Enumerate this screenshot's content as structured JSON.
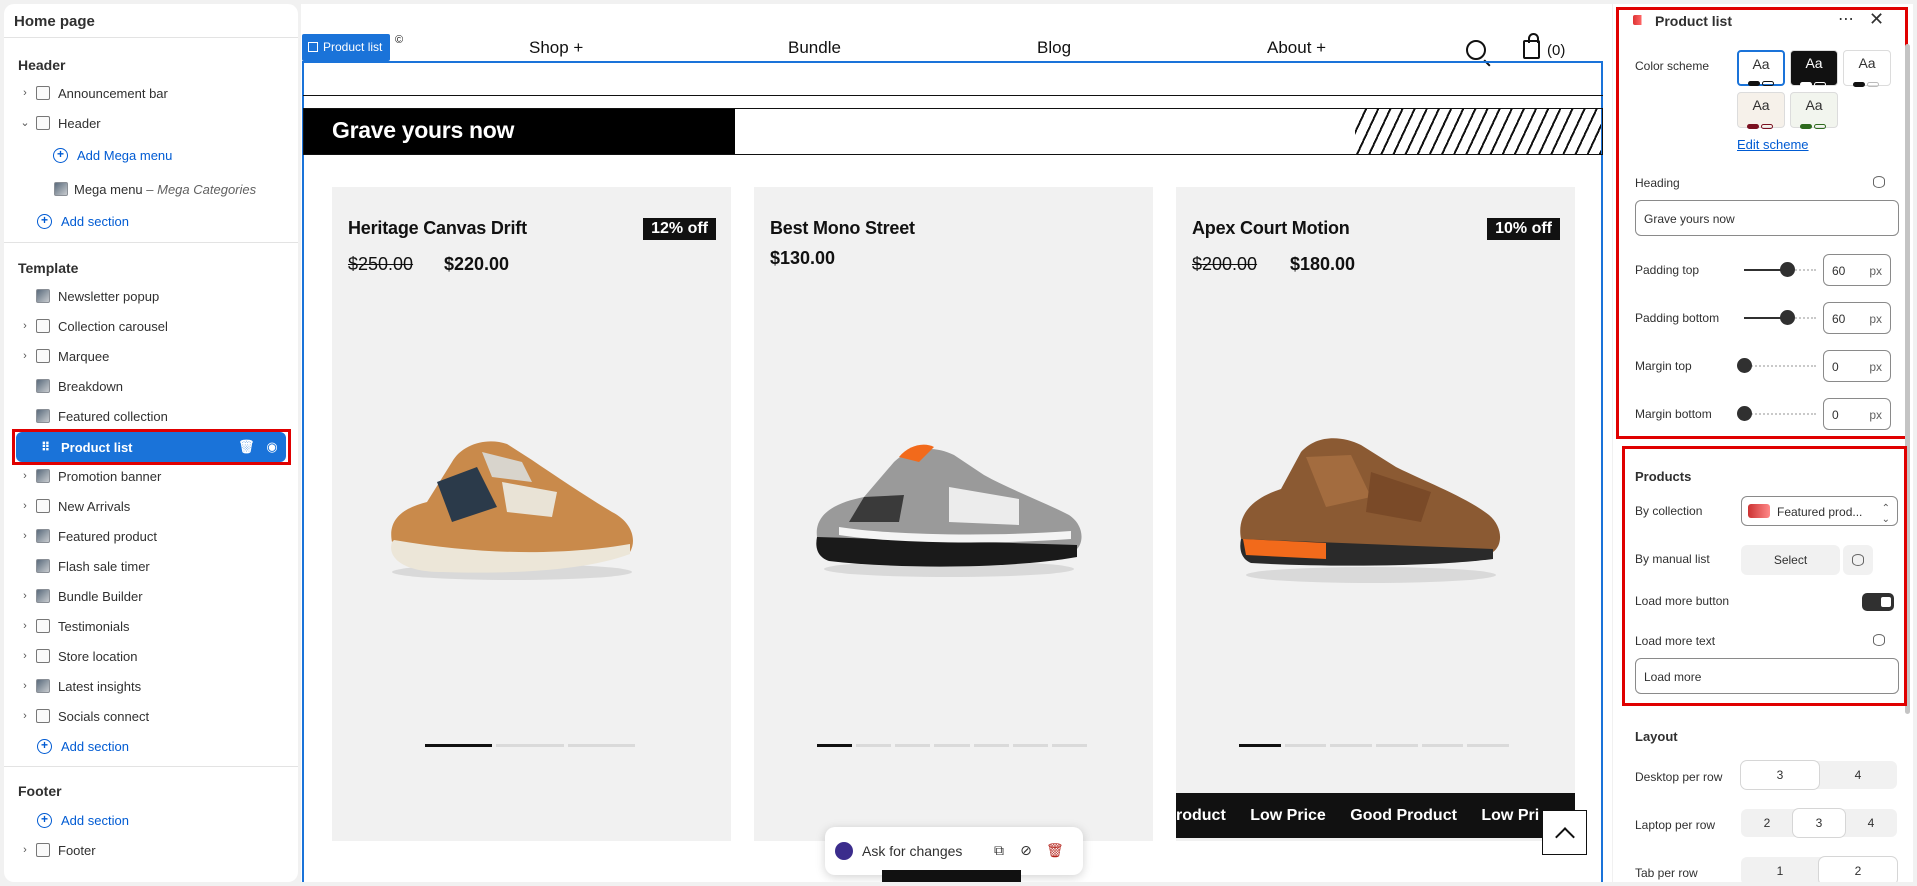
{
  "left_panel": {
    "title": "Home page",
    "header_group": "Header",
    "header_items": [
      "Announcement bar",
      "Header"
    ],
    "add_mega_menu": "Add Mega menu",
    "mega_menu": {
      "label": "Mega menu",
      "separator": " – ",
      "meta": "Mega Categories"
    },
    "add_section": "Add section",
    "template_group": "Template",
    "template_items": [
      "Newsletter popup",
      "Collection carousel",
      "Marquee",
      "Breakdown",
      "Featured collection",
      "Product list",
      "Promotion banner",
      "New Arrivals",
      "Featured product",
      "Flash sale timer",
      "Bundle Builder",
      "Testimonials",
      "Store location",
      "Latest insights",
      "Socials connect"
    ],
    "footer_group": "Footer",
    "footer_item": "Footer"
  },
  "preview": {
    "tag_label": "Product list",
    "nav": [
      "Shop +",
      "Bundle",
      "Blog",
      "About +"
    ],
    "cart_count": "(0)",
    "heading": "Grave yours now",
    "products": [
      {
        "name": "Heritage Canvas Drift",
        "old_price": "$250.00",
        "price": "$220.00",
        "badge": "12% off",
        "slides": 3
      },
      {
        "name": "Best Mono Street",
        "old_price": "",
        "price": "$130.00",
        "badge": "",
        "slides": 7
      },
      {
        "name": "Apex Court Motion",
        "old_price": "$200.00",
        "price": "$180.00",
        "badge": "10% off",
        "slides": 6
      }
    ],
    "marquee": [
      "roduct",
      "Low Price",
      "Good Product",
      "Low Pri"
    ],
    "ask_label": "Ask for changes"
  },
  "right_panel": {
    "title": "Product list",
    "color_scheme_label": "Color scheme",
    "swatch_text": "Aa",
    "edit_scheme": "Edit scheme",
    "heading_label": "Heading",
    "heading_value": "Grave yours now",
    "padding_top": {
      "label": "Padding top",
      "value": "60",
      "unit": "px",
      "level": 0.6
    },
    "padding_bottom": {
      "label": "Padding bottom",
      "value": "60",
      "unit": "px",
      "level": 0.6
    },
    "margin_top": {
      "label": "Margin top",
      "value": "0",
      "unit": "px",
      "level": 0
    },
    "margin_bottom": {
      "label": "Margin bottom",
      "value": "0",
      "unit": "px",
      "level": 0
    },
    "products_section": "Products",
    "by_collection_label": "By collection",
    "by_collection_value": "Featured prod...",
    "by_manual_label": "By manual list",
    "select_button": "Select",
    "load_more_button_label": "Load more button",
    "load_more_button_on": true,
    "load_more_text_label": "Load more text",
    "load_more_text_value": "Load more",
    "layout_section": "Layout",
    "desktop_per_row": {
      "label": "Desktop per row",
      "options": [
        "3",
        "4"
      ],
      "selected": "3"
    },
    "laptop_per_row": {
      "label": "Laptop per row",
      "options": [
        "2",
        "3",
        "4"
      ],
      "selected": "3"
    },
    "tab_per_row": {
      "label": "Tab per row",
      "options": [
        "1",
        "2"
      ],
      "selected": "2"
    }
  },
  "colors": {
    "accent": "#1a73d9",
    "highlight": "#e00000",
    "dark": "#111111",
    "link": "#005bd3"
  }
}
